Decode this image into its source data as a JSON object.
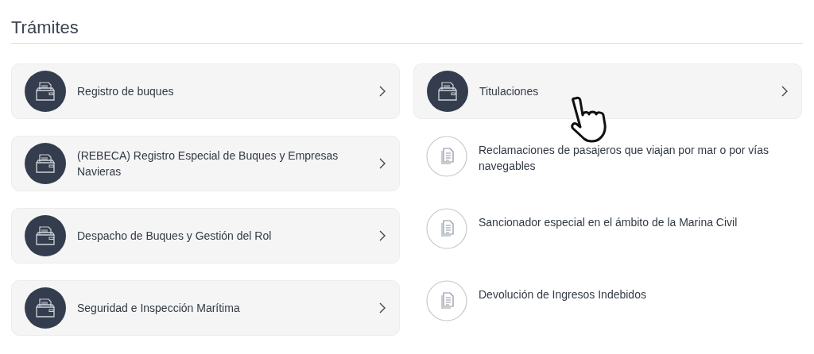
{
  "section": {
    "title": "Trámites"
  },
  "items": [
    {
      "kind": "group",
      "label": "Registro de buques"
    },
    {
      "kind": "group",
      "label": "(REBECA) Registro Especial de Buques y Empresas Navieras"
    },
    {
      "kind": "group",
      "label": "Despacho de Buques y Gestión del Rol"
    },
    {
      "kind": "group",
      "label": "Seguridad e Inspección Marítima"
    },
    {
      "kind": "group",
      "label": "Titulaciones"
    },
    {
      "kind": "procedure",
      "label": "Reclamaciones de pasajeros que viajan por mar o por vías navegables"
    },
    {
      "kind": "procedure",
      "label": "Sancionador especial en el ámbito de la Marina Civil"
    },
    {
      "kind": "procedure",
      "label": "Devolución de Ingresos Indebidos"
    }
  ]
}
